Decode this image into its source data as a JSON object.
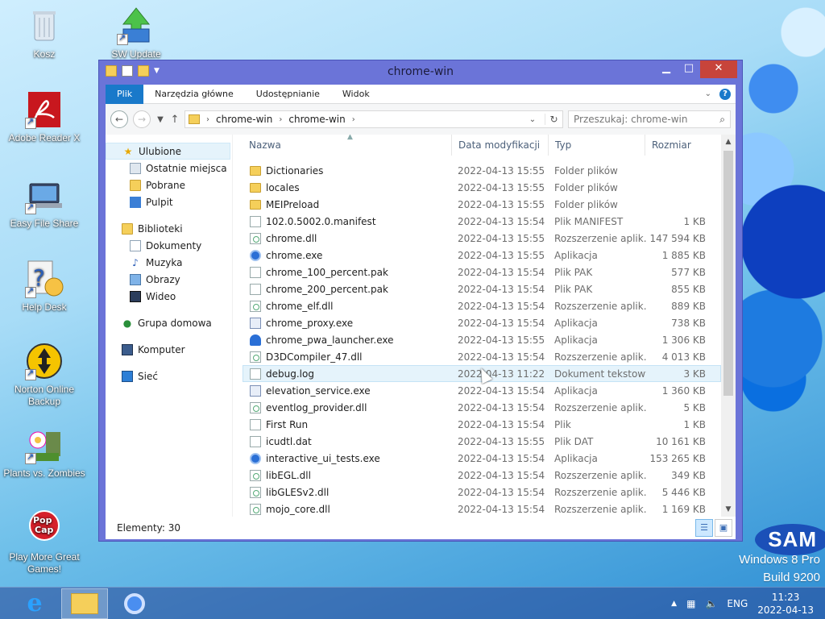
{
  "desktop": {
    "icons": [
      {
        "label": "Kosz",
        "icon": "recycle-bin-icon"
      },
      {
        "label": "SW Update",
        "icon": "sw-update-icon"
      },
      {
        "label": "Adobe Reader X",
        "icon": "adobe-reader-icon"
      },
      {
        "label": "Easy File Share",
        "icon": "easy-file-share-icon"
      },
      {
        "label": "Help Desk",
        "icon": "help-desk-icon"
      },
      {
        "label": "Norton Online Backup",
        "icon": "norton-icon"
      },
      {
        "label": "Plants vs. Zombies",
        "icon": "plants-vs-zombies-icon"
      },
      {
        "label": "Play More Great Games!",
        "icon": "popcap-icon"
      }
    ],
    "brand": {
      "os_line1": "Windows 8 Pro",
      "os_line2": "Build 9200",
      "logo": "SAM"
    }
  },
  "window": {
    "title": "chrome-win",
    "ribbon_tabs": [
      "Plik",
      "Narzędzia główne",
      "Udostępnianie",
      "Widok"
    ],
    "address": {
      "segments": [
        "chrome-win",
        "chrome-win"
      ]
    },
    "search": {
      "placeholder": "Przeszukaj: chrome-win"
    },
    "nav": {
      "favorites": {
        "label": "Ulubione",
        "items": [
          "Ostatnie miejsca",
          "Pobrane",
          "Pulpit"
        ]
      },
      "libraries": {
        "label": "Biblioteki",
        "items": [
          "Dokumenty",
          "Muzyka",
          "Obrazy",
          "Wideo"
        ]
      },
      "homegroup": "Grupa domowa",
      "computer": "Komputer",
      "network": "Sieć"
    },
    "columns": {
      "name": "Nazwa",
      "date": "Data modyfikacji",
      "type": "Typ",
      "size": "Rozmiar"
    },
    "files": [
      {
        "name": "Dictionaries",
        "date": "2022-04-13 15:55",
        "type": "Folder plików",
        "size": "",
        "icon": "folder"
      },
      {
        "name": "locales",
        "date": "2022-04-13 15:55",
        "type": "Folder plików",
        "size": "",
        "icon": "folder"
      },
      {
        "name": "MEIPreload",
        "date": "2022-04-13 15:55",
        "type": "Folder plików",
        "size": "",
        "icon": "folder"
      },
      {
        "name": "102.0.5002.0.manifest",
        "date": "2022-04-13 15:54",
        "type": "Plik MANIFEST",
        "size": "1 KB",
        "icon": "doc"
      },
      {
        "name": "chrome.dll",
        "date": "2022-04-13 15:55",
        "type": "Rozszerzenie aplik...",
        "size": "147 594 KB",
        "icon": "dll"
      },
      {
        "name": "chrome.exe",
        "date": "2022-04-13 15:55",
        "type": "Aplikacja",
        "size": "1 885 KB",
        "icon": "chrome"
      },
      {
        "name": "chrome_100_percent.pak",
        "date": "2022-04-13 15:54",
        "type": "Plik PAK",
        "size": "577 KB",
        "icon": "doc"
      },
      {
        "name": "chrome_200_percent.pak",
        "date": "2022-04-13 15:54",
        "type": "Plik PAK",
        "size": "855 KB",
        "icon": "doc"
      },
      {
        "name": "chrome_elf.dll",
        "date": "2022-04-13 15:54",
        "type": "Rozszerzenie aplik...",
        "size": "889 KB",
        "icon": "dll"
      },
      {
        "name": "chrome_proxy.exe",
        "date": "2022-04-13 15:54",
        "type": "Aplikacja",
        "size": "738 KB",
        "icon": "exe"
      },
      {
        "name": "chrome_pwa_launcher.exe",
        "date": "2022-04-13 15:55",
        "type": "Aplikacja",
        "size": "1 306 KB",
        "icon": "pwa"
      },
      {
        "name": "D3DCompiler_47.dll",
        "date": "2022-04-13 15:54",
        "type": "Rozszerzenie aplik...",
        "size": "4 013 KB",
        "icon": "dll"
      },
      {
        "name": "debug.log",
        "date": "2022-04-13 11:22",
        "type": "Dokument tekstowy",
        "size": "3 KB",
        "icon": "doc"
      },
      {
        "name": "elevation_service.exe",
        "date": "2022-04-13 15:54",
        "type": "Aplikacja",
        "size": "1 360 KB",
        "icon": "exe"
      },
      {
        "name": "eventlog_provider.dll",
        "date": "2022-04-13 15:54",
        "type": "Rozszerzenie aplik...",
        "size": "5 KB",
        "icon": "dll"
      },
      {
        "name": "First Run",
        "date": "2022-04-13 15:54",
        "type": "Plik",
        "size": "1 KB",
        "icon": "doc"
      },
      {
        "name": "icudtl.dat",
        "date": "2022-04-13 15:55",
        "type": "Plik DAT",
        "size": "10 161 KB",
        "icon": "doc"
      },
      {
        "name": "interactive_ui_tests.exe",
        "date": "2022-04-13 15:54",
        "type": "Aplikacja",
        "size": "153 265 KB",
        "icon": "chrome"
      },
      {
        "name": "libEGL.dll",
        "date": "2022-04-13 15:54",
        "type": "Rozszerzenie aplik...",
        "size": "349 KB",
        "icon": "dll"
      },
      {
        "name": "libGLESv2.dll",
        "date": "2022-04-13 15:54",
        "type": "Rozszerzenie aplik...",
        "size": "5 446 KB",
        "icon": "dll"
      },
      {
        "name": "mojo_core.dll",
        "date": "2022-04-13 15:54",
        "type": "Rozszerzenie aplik...",
        "size": "1 169 KB",
        "icon": "dll"
      }
    ],
    "hovered_file": "debug.log",
    "status": "Elementy: 30"
  },
  "taskbar": {
    "language": "ENG",
    "time": "11:23",
    "date": "2022-04-13"
  },
  "colors": {
    "accent": "#1979ca",
    "window_frame": "#6b74d8",
    "close": "#c7443b"
  }
}
